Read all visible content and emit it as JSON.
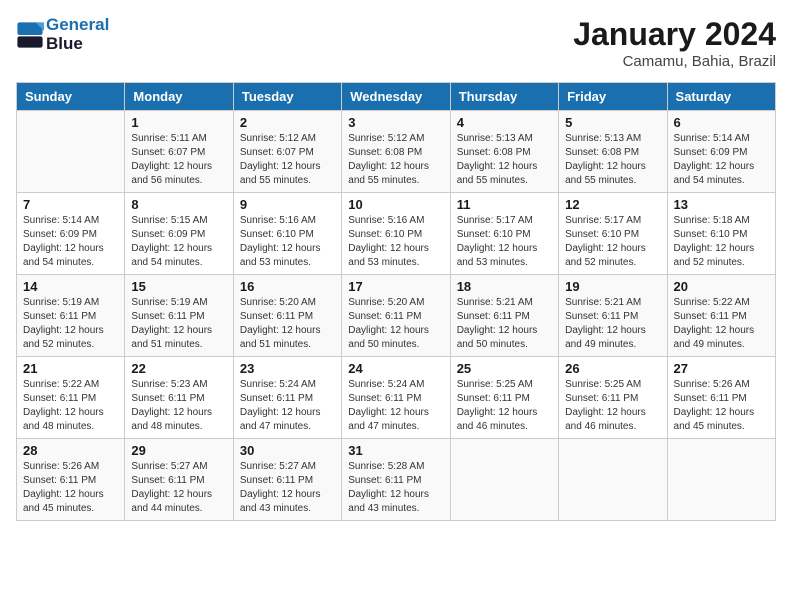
{
  "header": {
    "logo_line1": "General",
    "logo_line2": "Blue",
    "month": "January 2024",
    "location": "Camamu, Bahia, Brazil"
  },
  "days_of_week": [
    "Sunday",
    "Monday",
    "Tuesday",
    "Wednesday",
    "Thursday",
    "Friday",
    "Saturday"
  ],
  "weeks": [
    [
      {
        "day": "",
        "info": ""
      },
      {
        "day": "1",
        "info": "Sunrise: 5:11 AM\nSunset: 6:07 PM\nDaylight: 12 hours\nand 56 minutes."
      },
      {
        "day": "2",
        "info": "Sunrise: 5:12 AM\nSunset: 6:07 PM\nDaylight: 12 hours\nand 55 minutes."
      },
      {
        "day": "3",
        "info": "Sunrise: 5:12 AM\nSunset: 6:08 PM\nDaylight: 12 hours\nand 55 minutes."
      },
      {
        "day": "4",
        "info": "Sunrise: 5:13 AM\nSunset: 6:08 PM\nDaylight: 12 hours\nand 55 minutes."
      },
      {
        "day": "5",
        "info": "Sunrise: 5:13 AM\nSunset: 6:08 PM\nDaylight: 12 hours\nand 55 minutes."
      },
      {
        "day": "6",
        "info": "Sunrise: 5:14 AM\nSunset: 6:09 PM\nDaylight: 12 hours\nand 54 minutes."
      }
    ],
    [
      {
        "day": "7",
        "info": "Sunrise: 5:14 AM\nSunset: 6:09 PM\nDaylight: 12 hours\nand 54 minutes."
      },
      {
        "day": "8",
        "info": "Sunrise: 5:15 AM\nSunset: 6:09 PM\nDaylight: 12 hours\nand 54 minutes."
      },
      {
        "day": "9",
        "info": "Sunrise: 5:16 AM\nSunset: 6:10 PM\nDaylight: 12 hours\nand 53 minutes."
      },
      {
        "day": "10",
        "info": "Sunrise: 5:16 AM\nSunset: 6:10 PM\nDaylight: 12 hours\nand 53 minutes."
      },
      {
        "day": "11",
        "info": "Sunrise: 5:17 AM\nSunset: 6:10 PM\nDaylight: 12 hours\nand 53 minutes."
      },
      {
        "day": "12",
        "info": "Sunrise: 5:17 AM\nSunset: 6:10 PM\nDaylight: 12 hours\nand 52 minutes."
      },
      {
        "day": "13",
        "info": "Sunrise: 5:18 AM\nSunset: 6:10 PM\nDaylight: 12 hours\nand 52 minutes."
      }
    ],
    [
      {
        "day": "14",
        "info": "Sunrise: 5:19 AM\nSunset: 6:11 PM\nDaylight: 12 hours\nand 52 minutes."
      },
      {
        "day": "15",
        "info": "Sunrise: 5:19 AM\nSunset: 6:11 PM\nDaylight: 12 hours\nand 51 minutes."
      },
      {
        "day": "16",
        "info": "Sunrise: 5:20 AM\nSunset: 6:11 PM\nDaylight: 12 hours\nand 51 minutes."
      },
      {
        "day": "17",
        "info": "Sunrise: 5:20 AM\nSunset: 6:11 PM\nDaylight: 12 hours\nand 50 minutes."
      },
      {
        "day": "18",
        "info": "Sunrise: 5:21 AM\nSunset: 6:11 PM\nDaylight: 12 hours\nand 50 minutes."
      },
      {
        "day": "19",
        "info": "Sunrise: 5:21 AM\nSunset: 6:11 PM\nDaylight: 12 hours\nand 49 minutes."
      },
      {
        "day": "20",
        "info": "Sunrise: 5:22 AM\nSunset: 6:11 PM\nDaylight: 12 hours\nand 49 minutes."
      }
    ],
    [
      {
        "day": "21",
        "info": "Sunrise: 5:22 AM\nSunset: 6:11 PM\nDaylight: 12 hours\nand 48 minutes."
      },
      {
        "day": "22",
        "info": "Sunrise: 5:23 AM\nSunset: 6:11 PM\nDaylight: 12 hours\nand 48 minutes."
      },
      {
        "day": "23",
        "info": "Sunrise: 5:24 AM\nSunset: 6:11 PM\nDaylight: 12 hours\nand 47 minutes."
      },
      {
        "day": "24",
        "info": "Sunrise: 5:24 AM\nSunset: 6:11 PM\nDaylight: 12 hours\nand 47 minutes."
      },
      {
        "day": "25",
        "info": "Sunrise: 5:25 AM\nSunset: 6:11 PM\nDaylight: 12 hours\nand 46 minutes."
      },
      {
        "day": "26",
        "info": "Sunrise: 5:25 AM\nSunset: 6:11 PM\nDaylight: 12 hours\nand 46 minutes."
      },
      {
        "day": "27",
        "info": "Sunrise: 5:26 AM\nSunset: 6:11 PM\nDaylight: 12 hours\nand 45 minutes."
      }
    ],
    [
      {
        "day": "28",
        "info": "Sunrise: 5:26 AM\nSunset: 6:11 PM\nDaylight: 12 hours\nand 45 minutes."
      },
      {
        "day": "29",
        "info": "Sunrise: 5:27 AM\nSunset: 6:11 PM\nDaylight: 12 hours\nand 44 minutes."
      },
      {
        "day": "30",
        "info": "Sunrise: 5:27 AM\nSunset: 6:11 PM\nDaylight: 12 hours\nand 43 minutes."
      },
      {
        "day": "31",
        "info": "Sunrise: 5:28 AM\nSunset: 6:11 PM\nDaylight: 12 hours\nand 43 minutes."
      },
      {
        "day": "",
        "info": ""
      },
      {
        "day": "",
        "info": ""
      },
      {
        "day": "",
        "info": ""
      }
    ]
  ]
}
